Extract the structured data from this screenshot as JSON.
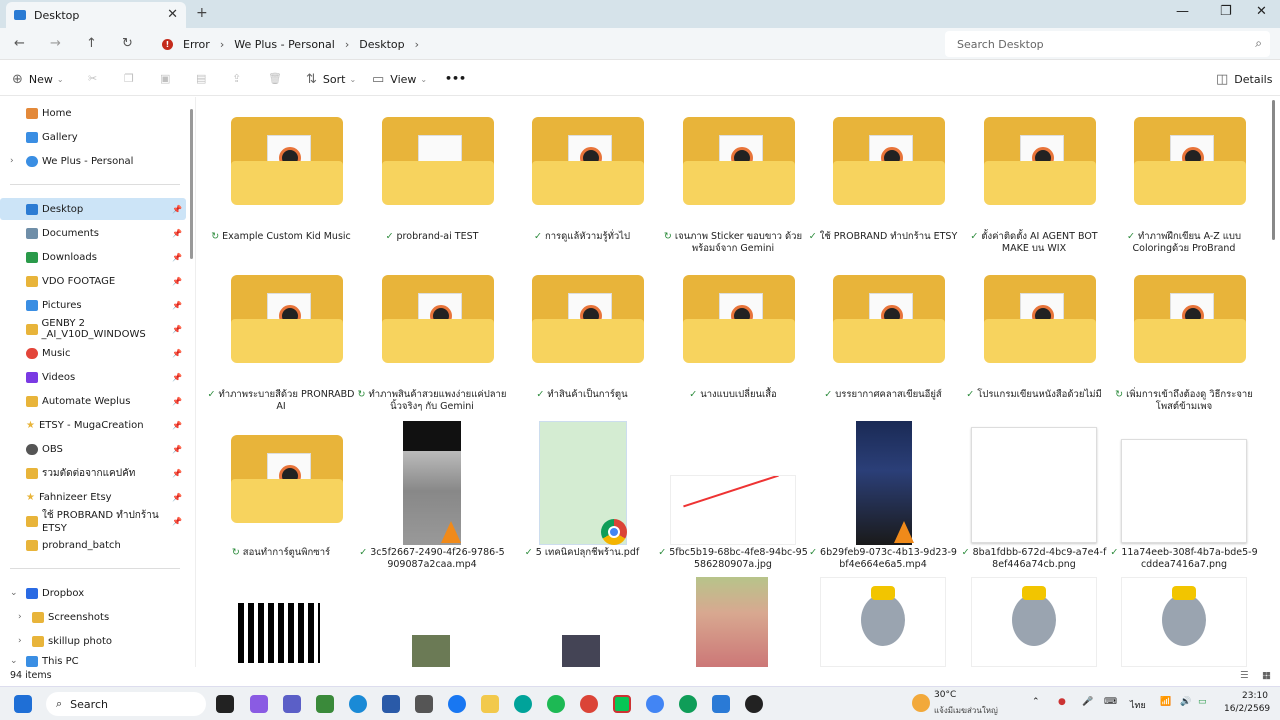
{
  "window": {
    "tab_title": "Desktop",
    "tab_icon": "folder-icon",
    "new_tab": "+",
    "minimize": "—",
    "maximize": "❐",
    "close": "✕"
  },
  "address": {
    "error": "Error",
    "crumb1": "We Plus - Personal",
    "crumb2": "Desktop",
    "search_placeholder": "Search Desktop"
  },
  "commands": {
    "new": "New",
    "sort": "Sort",
    "view": "View",
    "more": "•••",
    "details": "Details"
  },
  "sidebar": {
    "items": [
      {
        "label": "Home",
        "color": "#e3893a"
      },
      {
        "label": "Gallery",
        "color": "#3a8ee3"
      },
      {
        "label": "We Plus - Personal",
        "color": "#3a8ee3"
      },
      {
        "label": "Desktop",
        "color": "#2b7bd3"
      },
      {
        "label": "Documents",
        "color": "#6f8ea8"
      },
      {
        "label": "Downloads",
        "color": "#2a9a4a"
      },
      {
        "label": "VDO FOOTAGE",
        "color": "#e8b43a"
      },
      {
        "label": "Pictures",
        "color": "#3a8ee3"
      },
      {
        "label": "GENBY 2 _AI_V10D_WINDOWS",
        "color": "#e8b43a"
      },
      {
        "label": "Music",
        "color": "#e3453a"
      },
      {
        "label": "Videos",
        "color": "#7a3ae3"
      },
      {
        "label": "Automate Weplus",
        "color": "#e8b43a"
      },
      {
        "label": "ETSY - MugaCreation",
        "color": "#e8b43a"
      },
      {
        "label": "OBS",
        "color": "#555555"
      },
      {
        "label": "รวมตัดต่อจากแคปคัท",
        "color": "#e8b43a"
      },
      {
        "label": "Fahnizeer Etsy",
        "color": "#e8b43a"
      },
      {
        "label": "ใช้ PROBRAND ทำปกร้าน ETSY",
        "color": "#e8b43a"
      },
      {
        "label": "probrand_batch",
        "color": "#e8b43a"
      },
      {
        "label": "Dropbox",
        "color": "#2a6ae3"
      },
      {
        "label": "Screenshots",
        "color": "#e8b43a"
      },
      {
        "label": "skillup photo",
        "color": "#e8b43a"
      },
      {
        "label": "This PC",
        "color": "#3a8ee3"
      }
    ]
  },
  "files": [
    {
      "name": "Example Custom Kid Music",
      "kind": "folder"
    },
    {
      "name": "probrand-ai TEST",
      "kind": "folder"
    },
    {
      "name": "การดูแล้หัวามรู้ทั่วไป",
      "kind": "folder"
    },
    {
      "name": "เจนภาพ Sticker ขอบขาว ด้วย พร้อมจ์จาก Gemini",
      "kind": "folder"
    },
    {
      "name": "ใช้ PROBRAND ทำปกร้าน ETSY",
      "kind": "folder"
    },
    {
      "name": "ตั้งค่าติดตั้ง AI AGENT BOT MAKE บน WIX",
      "kind": "folder"
    },
    {
      "name": "ทำภาพฝึกเขียน A-Z แบบ Coloringด้วย ProBrand",
      "kind": "folder"
    },
    {
      "name": "ทำภาพระบายสีด้วย PRONRABD AI",
      "kind": "folder"
    },
    {
      "name": "ทำภาพสินค้าสวยแพงง่ายแค่ปลาย นิ้วจริงๆ กับ Gemini",
      "kind": "folder"
    },
    {
      "name": "ทำสินค้าเป็นการ์ตูน",
      "kind": "folder"
    },
    {
      "name": "นางแบบเปลี่ยนเสื้อ",
      "kind": "folder"
    },
    {
      "name": "บรรยากาศคลาสเขียนอียู่ส์",
      "kind": "folder"
    },
    {
      "name": "โปรแกรมเขียนหนังสือด้วยไม่มี",
      "kind": "folder"
    },
    {
      "name": "เพิ่มการเข้าถึงต้องดู วิธีกระจาย โพสต์ข้ามเพจ",
      "kind": "folder"
    },
    {
      "name": "สอนทำการ์ตูนพิกซาร์",
      "kind": "folder"
    },
    {
      "name": "3c5f2667-2490-4f26-9786-5 909087a2caa.mp4",
      "kind": "video"
    },
    {
      "name": "5 เทคนิคปลุกชีพร้าน.pdf",
      "kind": "pdf"
    },
    {
      "name": "5fbc5b19-68bc-4fe8-94bc-95 586280907a.jpg",
      "kind": "image"
    },
    {
      "name": "6b29feb9-073c-4b13-9d23-9 bf4e664e6a5.mp4",
      "kind": "video"
    },
    {
      "name": "8ba1fdbb-672d-4bc9-a7e4-f 8ef446a74cb.png",
      "kind": "doc"
    },
    {
      "name": "11a74eeb-308f-4b7a-bde5-9 cddea7416a7.png",
      "kind": "doc"
    }
  ],
  "status": {
    "count": "94 items"
  },
  "taskbar": {
    "search": "Search",
    "weather_temp": "30°C",
    "weather_desc": "แจ้งมีเมฆส่วนใหญ่",
    "lang": "ไทย",
    "time": "23:10",
    "date": "16/2/2569"
  }
}
